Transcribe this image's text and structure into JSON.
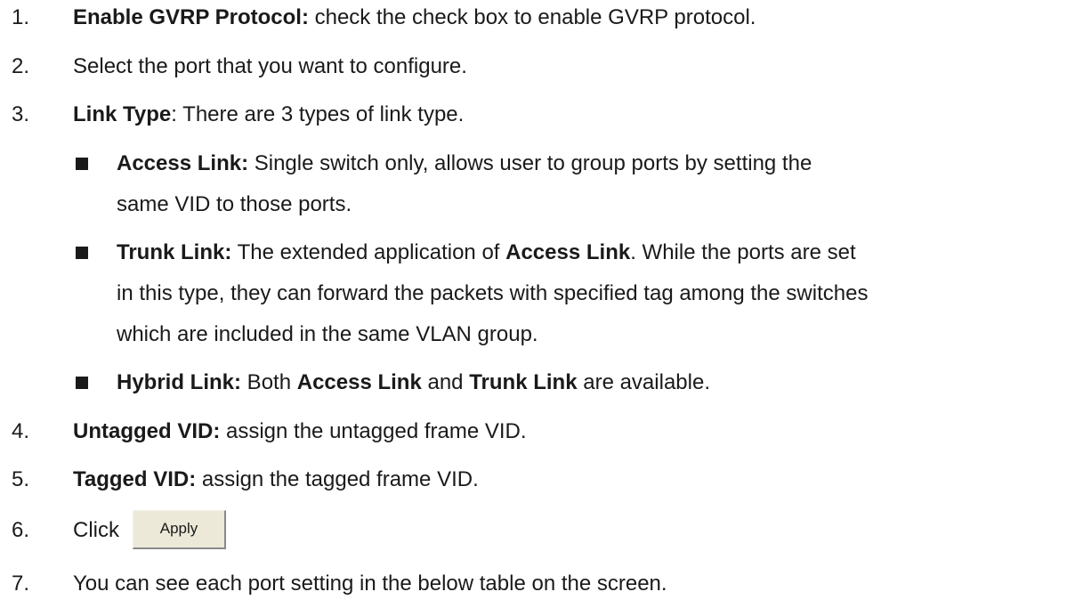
{
  "steps": [
    {
      "num": "1.",
      "bold": "Enable GVRP Protocol:",
      "rest": " check the check box to enable GVRP protocol."
    },
    {
      "num": "2.",
      "bold": "",
      "rest": "Select the port that you want to configure."
    },
    {
      "num": "3.",
      "bold": "Link Type",
      "rest": ": There are 3 types of link type."
    },
    {
      "num": "4.",
      "bold": "Untagged VID:",
      "rest": " assign the untagged frame VID."
    },
    {
      "num": "5.",
      "bold": "Tagged VID:",
      "rest": " assign the tagged frame VID."
    },
    {
      "num": "6.",
      "text": "Click",
      "button": "Apply"
    },
    {
      "num": "7.",
      "bold": "",
      "rest": "You can see each port setting in the below table on the screen."
    }
  ],
  "link_types": {
    "access": {
      "bold": "Access Link:",
      "line1": " Single switch only, allows user to group ports by setting the",
      "line2": "same VID to those ports."
    },
    "trunk": {
      "bold": "Trunk Link:",
      "line1a": " The extended application of ",
      "line1b": "Access Link",
      "line1c": ". While the ports are set",
      "line2": "in this type, they can forward the packets with specified tag among the switches",
      "line3": "which are included in the same VLAN group."
    },
    "hybrid": {
      "bold": "Hybrid Link:",
      "p1": " Both ",
      "b1": "Access Link",
      "p2": " and ",
      "b2": "Trunk Link",
      "p3": " are available."
    }
  }
}
